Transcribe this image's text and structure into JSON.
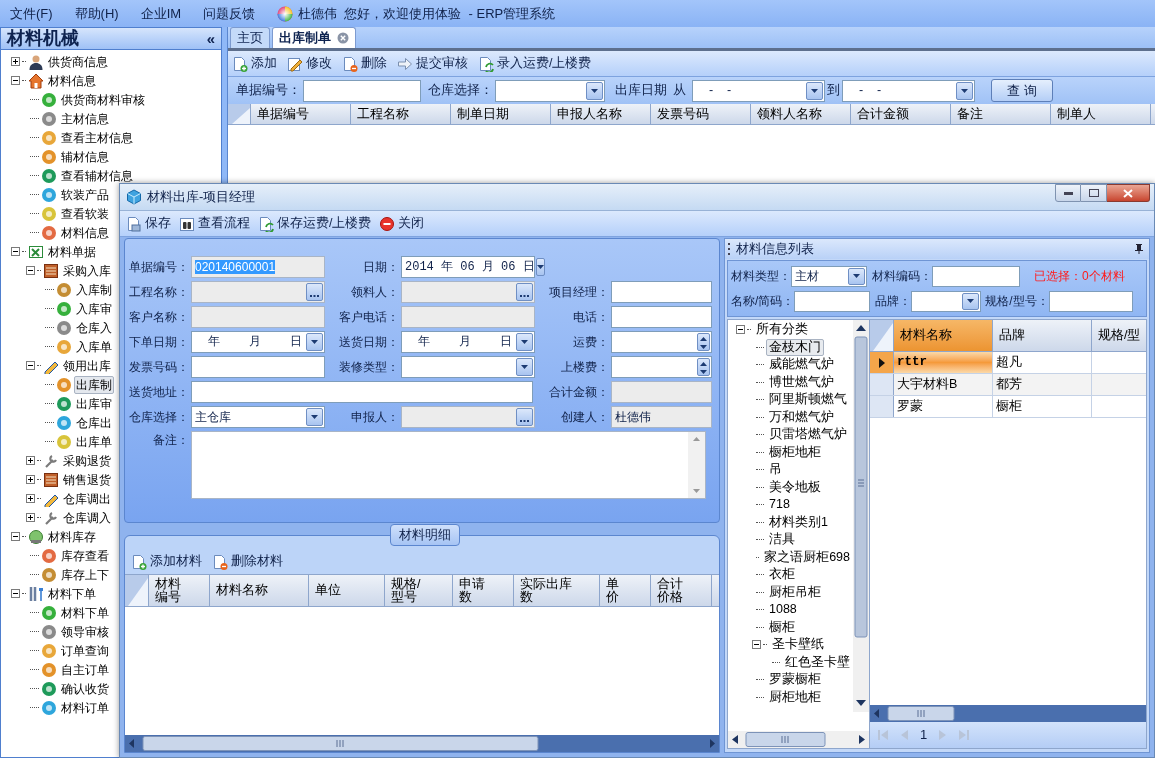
{
  "menu_bar": {
    "items": [
      "文件(F)",
      "帮助(H)",
      "企业IM",
      "问题反馈"
    ],
    "greeting": "杜德伟  您好，欢迎使用体验  - ERP管理系统"
  },
  "sidebar": {
    "title": "材料机械",
    "collapse": "«",
    "tree": [
      {
        "label": "供货商信息",
        "expanded": false,
        "selected": false
      },
      {
        "label": "材料信息",
        "expanded": true,
        "selected": false,
        "children": [
          {
            "label": "供货商材料审核",
            "selected": false
          },
          {
            "label": "主材信息",
            "selected": false
          },
          {
            "label": "查看主材信息",
            "selected": false
          },
          {
            "label": "辅材信息",
            "selected": false
          },
          {
            "label": "查看辅材信息",
            "selected": false
          },
          {
            "label": "软装产品",
            "selected": false
          },
          {
            "label": "查看软装",
            "selected": false
          },
          {
            "label": "材料信息",
            "selected": false
          }
        ]
      },
      {
        "label": "材料单据",
        "expanded": true,
        "selected": false,
        "children": [
          {
            "label": "采购入库",
            "expanded": true,
            "selected": false,
            "children": [
              {
                "label": "入库制",
                "selected": false
              },
              {
                "label": "入库审",
                "selected": false
              },
              {
                "label": "仓库入",
                "selected": false
              },
              {
                "label": "入库单",
                "selected": false
              }
            ]
          },
          {
            "label": "领用出库",
            "expanded": true,
            "selected": false,
            "children": [
              {
                "label": "出库制",
                "selected": true
              },
              {
                "label": "出库审",
                "selected": false
              },
              {
                "label": "仓库出",
                "selected": false
              },
              {
                "label": "出库单",
                "selected": false
              }
            ]
          },
          {
            "label": "采购退货",
            "expanded": false,
            "selected": false
          },
          {
            "label": "销售退货",
            "expanded": false,
            "selected": false
          },
          {
            "label": "仓库调出",
            "expanded": false,
            "selected": false
          },
          {
            "label": "仓库调入",
            "expanded": false,
            "selected": false
          }
        ]
      },
      {
        "label": "材料库存",
        "expanded": true,
        "selected": false,
        "children": [
          {
            "label": "库存查看",
            "selected": false
          },
          {
            "label": "库存上下",
            "selected": false
          }
        ]
      },
      {
        "label": "材料下单",
        "expanded": true,
        "selected": false,
        "children": [
          {
            "label": "材料下单",
            "selected": false
          },
          {
            "label": "领导审核",
            "selected": false
          },
          {
            "label": "订单查询",
            "selected": false
          },
          {
            "label": "自主订单",
            "selected": false
          },
          {
            "label": "确认收货",
            "selected": false
          },
          {
            "label": "材料订单",
            "selected": false
          }
        ]
      }
    ]
  },
  "tabs": [
    {
      "label": "主页",
      "selected": false,
      "closable": false
    },
    {
      "label": "出库制单",
      "selected": true,
      "closable": true
    }
  ],
  "toolbar": [
    "添加",
    "修改",
    "删除",
    "提交审核",
    "录入运费/上楼费"
  ],
  "filters": {
    "doc_no_label": "单据编号：",
    "warehouse_label": "仓库选择：",
    "date_label": "出库日期",
    "from_label": "从",
    "from_value": "-    -",
    "to_label": "到",
    "to_value": "-    -",
    "query_button": "查 询"
  },
  "grid": {
    "columns": [
      "单据编号",
      "工程名称",
      "制单日期",
      "申报人名称",
      "发票号码",
      "领料人名称",
      "合计金额",
      "备注",
      "制单人"
    ]
  },
  "dialog": {
    "title": "材料出库-项目经理",
    "toolbar": [
      "保存",
      "查看流程",
      "保存运费/上楼费",
      "关闭"
    ],
    "form_rows": [
      [
        {
          "label": "单据编号：",
          "kind": "text",
          "value": "020140600001",
          "readonly": true,
          "highlighted": true
        },
        {
          "label": "日期：",
          "kind": "date",
          "value": "2014 年 06 月 06 日",
          "readonly": false
        }
      ],
      [
        {
          "label": "工程名称：",
          "kind": "lookup",
          "readonly": true
        },
        {
          "label": "领料人：",
          "kind": "lookup",
          "readonly": true
        },
        {
          "label": "项目经理：",
          "kind": "text",
          "readonly": false
        }
      ],
      [
        {
          "label": "客户名称：",
          "kind": "text",
          "readonly": true
        },
        {
          "label": "客户电话：",
          "kind": "text",
          "readonly": true
        },
        {
          "label": "电话：",
          "kind": "text",
          "readonly": false
        }
      ],
      [
        {
          "label": "下单日期：",
          "kind": "date",
          "value": "年    月    日",
          "readonly": false
        },
        {
          "label": "送货日期：",
          "kind": "date",
          "value": "年    月    日",
          "readonly": false
        },
        {
          "label": "运费：",
          "kind": "spin",
          "readonly": false
        }
      ],
      [
        {
          "label": "发票号码：",
          "kind": "text",
          "readonly": false
        },
        {
          "label": "装修类型：",
          "kind": "dropdown",
          "readonly": false
        },
        {
          "label": "上楼费：",
          "kind": "spin",
          "readonly": false
        }
      ],
      [
        {
          "label": "送货地址：",
          "kind": "wide",
          "readonly": false
        },
        {
          "label": "合计金额：",
          "kind": "text",
          "readonly": true
        }
      ],
      [
        {
          "label": "仓库选择：",
          "kind": "dropdown",
          "value": "主仓库",
          "readonly": false
        },
        {
          "label": "申报人：",
          "kind": "lookup",
          "readonly": true
        },
        {
          "label": "创建人：",
          "kind": "text",
          "value": "杜德伟",
          "readonly": true
        }
      ]
    ],
    "remarks_label": "备注：",
    "detail": {
      "legend": "材料明细",
      "toolbar": [
        "添加材料",
        "删除材料"
      ],
      "columns": [
        "材料编号",
        "材料名称",
        "单位",
        "规格/型号",
        "申请数",
        "实际出库数",
        "单价",
        "合计价格"
      ]
    },
    "material_panel": {
      "title": "材料信息列表",
      "type_label": "材料类型：",
      "type_value": "主材",
      "code_label": "材料编码：",
      "selected_count": "已选择：0个材料",
      "name_label": "名称/简码：",
      "brand_label": "品牌：",
      "spec_label": "规格/型号：",
      "tree": {
        "label": "所有分类",
        "expanded": true,
        "selected": false,
        "children": [
          {
            "label": "金枝木门",
            "selected": true
          },
          {
            "label": "威能燃气炉",
            "selected": false
          },
          {
            "label": "博世燃气炉",
            "selected": false
          },
          {
            "label": "阿里斯顿燃气",
            "selected": false
          },
          {
            "label": "万和燃气炉",
            "selected": false
          },
          {
            "label": "贝雷塔燃气炉",
            "selected": false
          },
          {
            "label": "橱柜地柜",
            "selected": false
          },
          {
            "label": "吊",
            "selected": false
          },
          {
            "label": "美令地板",
            "selected": false
          },
          {
            "label": "718",
            "selected": false
          },
          {
            "label": "材料类别1",
            "selected": false
          },
          {
            "label": "洁具",
            "selected": false
          },
          {
            "label": "家之语厨柜698",
            "selected": false
          },
          {
            "label": "衣柜",
            "selected": false
          },
          {
            "label": "厨柜吊柜",
            "selected": false
          },
          {
            "label": "1088",
            "selected": false
          },
          {
            "label": "橱柜",
            "selected": false
          },
          {
            "label": "圣卡壁纸",
            "expanded": true,
            "selected": false,
            "children": [
              {
                "label": "红色圣卡壁",
                "selected": false
              }
            ]
          },
          {
            "label": "罗蒙橱柜",
            "selected": false
          },
          {
            "label": "厨柜地柜",
            "selected": false
          }
        ]
      },
      "columns": [
        {
          "label": "材料名称",
          "selected": true
        },
        {
          "label": "品牌",
          "selected": false
        },
        {
          "label": "规格/型",
          "selected": false
        }
      ],
      "rows": [
        {
          "cells": [
            "rttr",
            "超凡"
          ],
          "selected": true
        },
        {
          "cells": [
            "大宇材料B",
            "都芳"
          ],
          "selected": false
        },
        {
          "cells": [
            "罗蒙",
            "橱柜"
          ],
          "selected": false
        }
      ],
      "page": "1"
    }
  }
}
